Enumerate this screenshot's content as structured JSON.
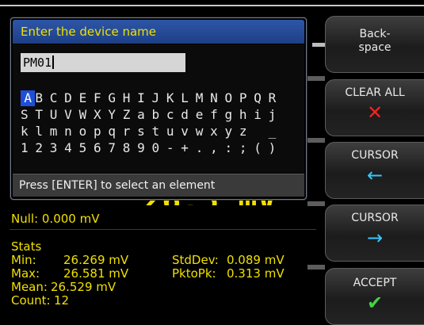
{
  "dialog": {
    "title": "Enter the device name",
    "input_value": "PM01",
    "char_rows": [
      [
        "A",
        "B",
        "C",
        "D",
        "E",
        "F",
        "G",
        "H",
        "I",
        "J",
        "K",
        "L",
        "M",
        "N",
        "O",
        "P",
        "Q",
        "R"
      ],
      [
        "S",
        "T",
        "U",
        "V",
        "W",
        "X",
        "Y",
        "Z",
        "a",
        "b",
        "c",
        "d",
        "e",
        "f",
        "g",
        "h",
        "i",
        "j"
      ],
      [
        "k",
        "l",
        "m",
        "n",
        "o",
        "p",
        "q",
        "r",
        "s",
        "t",
        "u",
        "v",
        "w",
        "x",
        "y",
        "z",
        " ",
        "_"
      ],
      [
        "1",
        "2",
        "3",
        "4",
        "5",
        "6",
        "7",
        "8",
        "9",
        "0",
        "-",
        "+",
        ".",
        ",",
        ":",
        ";",
        "(",
        ")"
      ]
    ],
    "selected_char": "A",
    "status": "Press [ENTER] to select an element"
  },
  "measurement": {
    "big_value_fragment": "26.5 mV",
    "null_label": "Null: 0.000 mV",
    "stats_title": "Stats",
    "min_label": "Min:",
    "min_value": "26.269 mV",
    "max_label": "Max:",
    "max_value": "26.581 mV",
    "mean_label": "Mean:",
    "mean_value": "26.529 mV",
    "count_label": "Count:",
    "count_value": "12",
    "stddev_label": "StdDev:",
    "stddev_value": "0.089 mV",
    "pktopk_label": "PktoPk:",
    "pktopk_value": "0.313 mV"
  },
  "softkeys": [
    {
      "label": "Back-\nspace",
      "symbol": "",
      "symbol_color": "#ffffff"
    },
    {
      "label": "CLEAR ALL",
      "symbol": "✕",
      "symbol_color": "#ff2020"
    },
    {
      "label": "CURSOR",
      "symbol": "←",
      "symbol_color": "#36c8ff"
    },
    {
      "label": "CURSOR",
      "symbol": "→",
      "symbol_color": "#36c8ff"
    },
    {
      "label": "ACCEPT",
      "symbol": "✔",
      "symbol_color": "#43d243"
    }
  ],
  "colors": {
    "accent_yellow": "#f0e000",
    "title_blue": "#2d56a8",
    "selection_blue": "#1f4ed8"
  }
}
